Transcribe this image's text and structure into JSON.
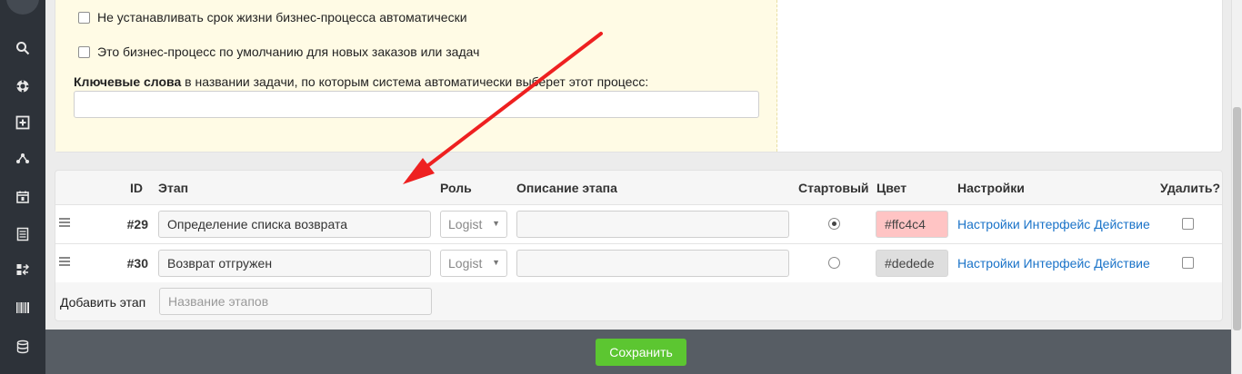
{
  "settings": {
    "no_lifetime_label": "Не устанавливать срок жизни бизнес-процесса автоматически",
    "default_process_label": "Это бизнес-процесс по умолчанию для новых заказов или задач",
    "keywords_bold": "Ключевые слова",
    "keywords_rest": " в названии задачи, по которым система автоматически выберет этот процесс:",
    "keywords_value": ""
  },
  "stages_table": {
    "headers": {
      "id": "ID",
      "stage": "Этап",
      "role": "Роль",
      "description": "Описание этапа",
      "starting": "Стартовый",
      "color": "Цвет",
      "settings": "Настройки",
      "delete": "Удалить?"
    },
    "rows": [
      {
        "id": "#29",
        "name": "Определение списка возврата",
        "role": "Logist",
        "description": "",
        "starting": true,
        "color": "#ffc4c4",
        "links": [
          "Настройки",
          "Интерфейс",
          "Действие"
        ],
        "delete": false
      },
      {
        "id": "#30",
        "name": "Возврат отгружен",
        "role": "Logist",
        "description": "",
        "starting": false,
        "color": "#dedede",
        "links": [
          "Настройки",
          "Интерфейс",
          "Действие"
        ],
        "delete": false
      }
    ],
    "add_stage_label": "Добавить этап",
    "add_stage_placeholder": "Название этапов"
  },
  "footer": {
    "save_label": "Сохранить",
    "save_color": "#5cc631"
  },
  "nav_icons": [
    "search-icon",
    "lifebuoy-icon",
    "add-box-icon",
    "share-nodes-icon",
    "calendar-icon",
    "list-icon",
    "transfer-icon",
    "barcode-icon",
    "database-icon"
  ],
  "annotation": {
    "arrow_color": "#ee2020"
  }
}
